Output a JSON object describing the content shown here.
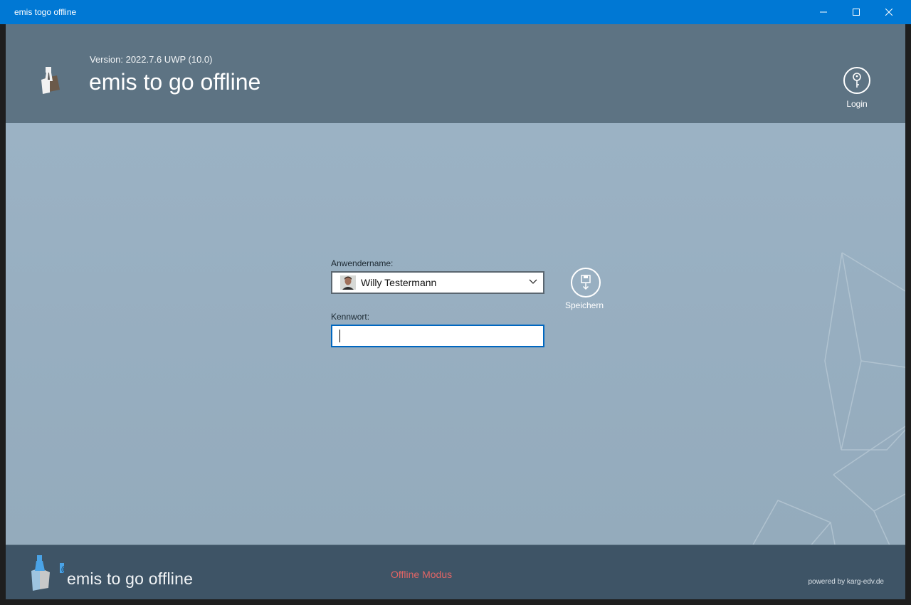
{
  "window": {
    "title": "emis togo offline"
  },
  "header": {
    "version": "Version: 2022.7.6 UWP (10.0)",
    "title": "emis to go offline",
    "login_label": "Login"
  },
  "form": {
    "username_label": "Anwendername:",
    "username_value": "Willy Testermann",
    "password_label": "Kennwort:",
    "password_value": "",
    "save_label": "Speichern"
  },
  "footer": {
    "app_name": "emis to go offline",
    "status": "Offline Modus",
    "powered_by": "powered by karg-edv.de"
  },
  "icons": [
    "app-logo-icon",
    "minimize-icon",
    "maximize-icon",
    "close-icon",
    "key-icon",
    "save-icon",
    "chevron-down-icon",
    "avatar",
    "footer-logo-icon"
  ],
  "colors": {
    "titlebar": "#0078d4",
    "header": "#5d7383",
    "footer": "#3e5466",
    "accent": "#0067c0",
    "offline": "#e06565"
  }
}
